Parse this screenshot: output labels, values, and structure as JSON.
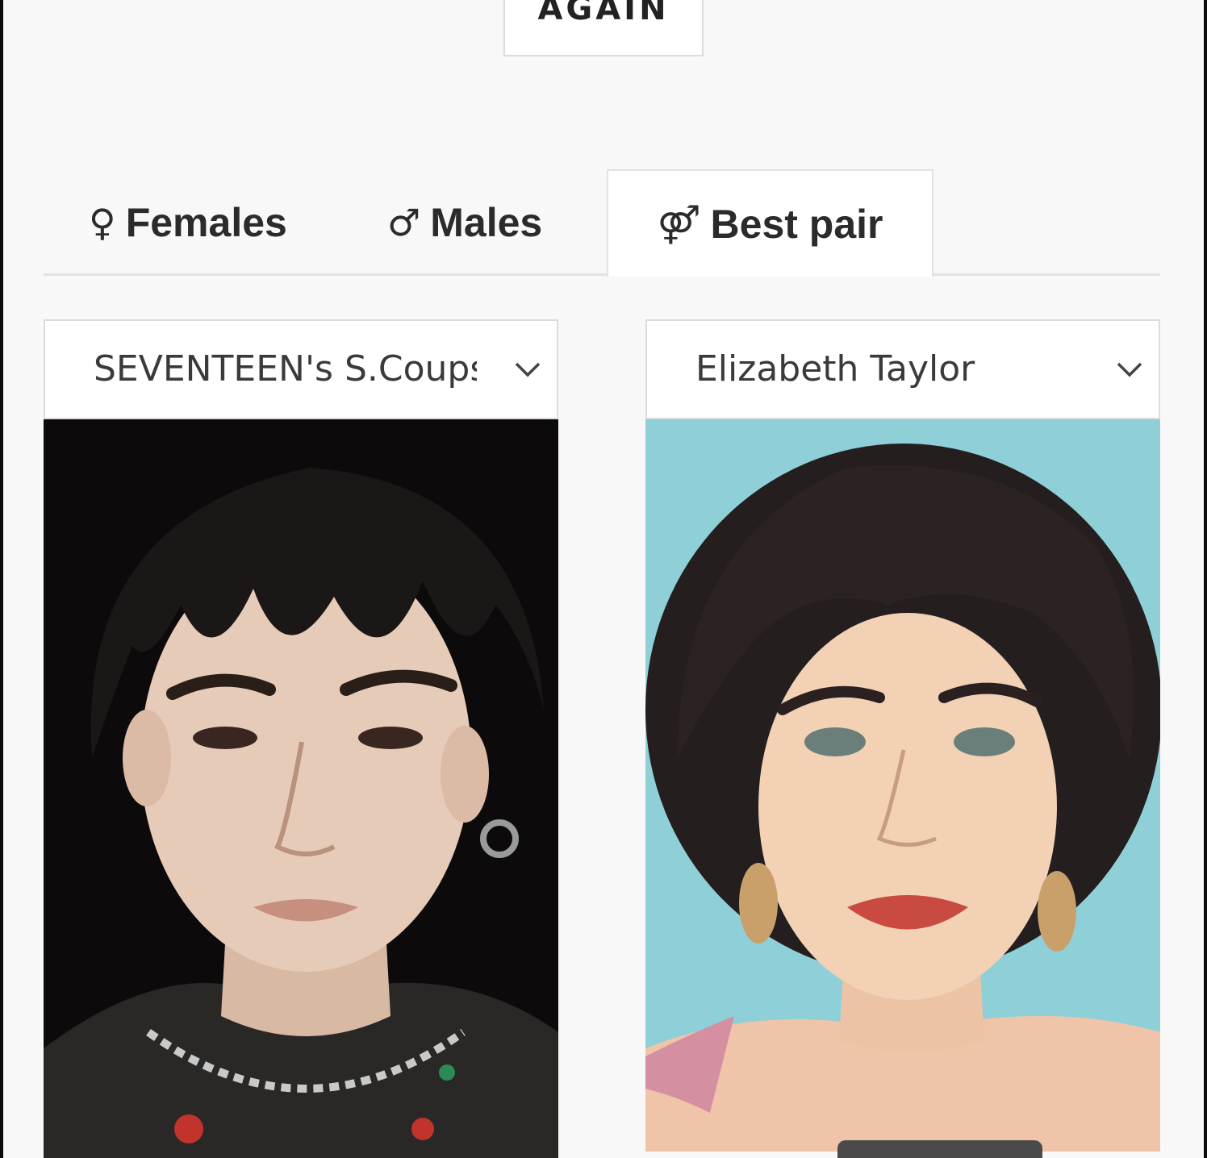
{
  "again_button": {
    "label": "AGAIN"
  },
  "tabs": [
    {
      "symbol": "♀",
      "label": "Females",
      "active": false
    },
    {
      "symbol": "♂",
      "label": "Males",
      "active": false
    },
    {
      "symbol": "⚤",
      "label": "Best pair",
      "active": true
    }
  ],
  "left_person": {
    "selected": "SEVENTEEN's S.Coups"
  },
  "right_person": {
    "selected": "Elizabeth Taylor"
  },
  "colors": {
    "page_bg": "#f8f8f8",
    "border": "#dcdcdc",
    "text": "#2b2b2b"
  },
  "icons": {
    "dropdown": "chevron-down-icon"
  }
}
